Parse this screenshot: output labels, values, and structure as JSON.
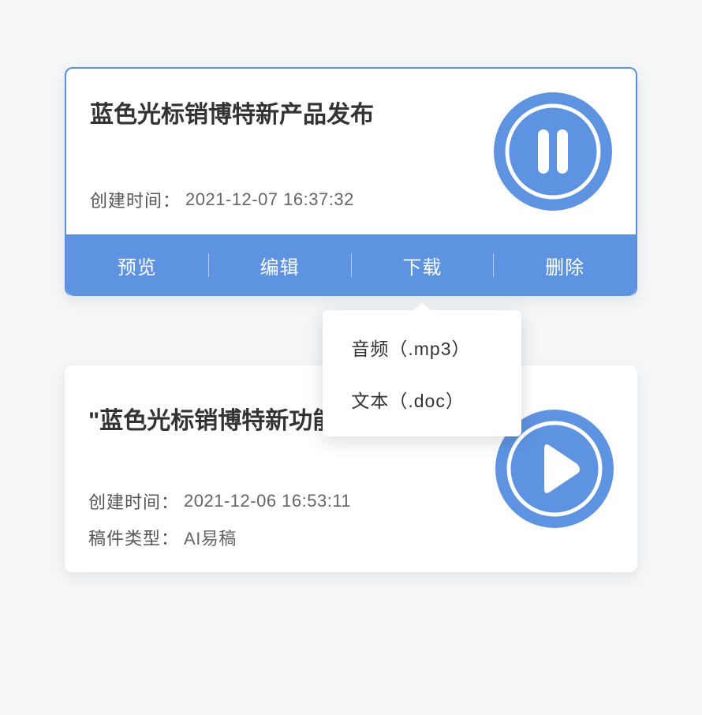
{
  "cards": [
    {
      "title": "蓝色光标销博特新产品发布",
      "created_label": "创建时间：",
      "created_value": "2021-12-07 16:37:32",
      "media_state": "playing"
    },
    {
      "title": "\"蓝色光标销博特新功能发布会",
      "created_label": "创建时间：",
      "created_value": "2021-12-06 16:53:11",
      "doc_type_label": "稿件类型：",
      "doc_type_value": "AI易稿",
      "media_state": "paused"
    }
  ],
  "actions": {
    "preview": "预览",
    "edit": "编辑",
    "download": "下载",
    "delete": "删除"
  },
  "download_menu": {
    "mp3": "音频（.mp3）",
    "doc": "文本（.doc）"
  }
}
